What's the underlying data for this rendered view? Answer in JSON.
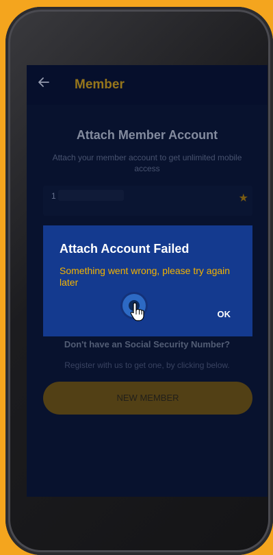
{
  "appbar": {
    "title": "Member",
    "back_icon": "arrow-left-icon"
  },
  "main": {
    "heading": "Attach Member Account",
    "subheading": "Attach your member account to get unlimited mobile access",
    "field_value": "1",
    "favorite_icon": "star-icon",
    "no_ssn_question": "Don't have an Social Security Number?",
    "register_hint": "Register with us to get one, by clicking below.",
    "new_member_label": "NEW MEMBER"
  },
  "dialog": {
    "title": "Attach Account Failed",
    "message": "Something went wrong, please try again later",
    "ok_label": "OK"
  },
  "colors": {
    "background": "#f4a51e",
    "screen_bg": "#0a1433",
    "accent_gold": "#c79a1a",
    "dialog_bg": "#143a8f",
    "dialog_message": "#f5b400"
  }
}
